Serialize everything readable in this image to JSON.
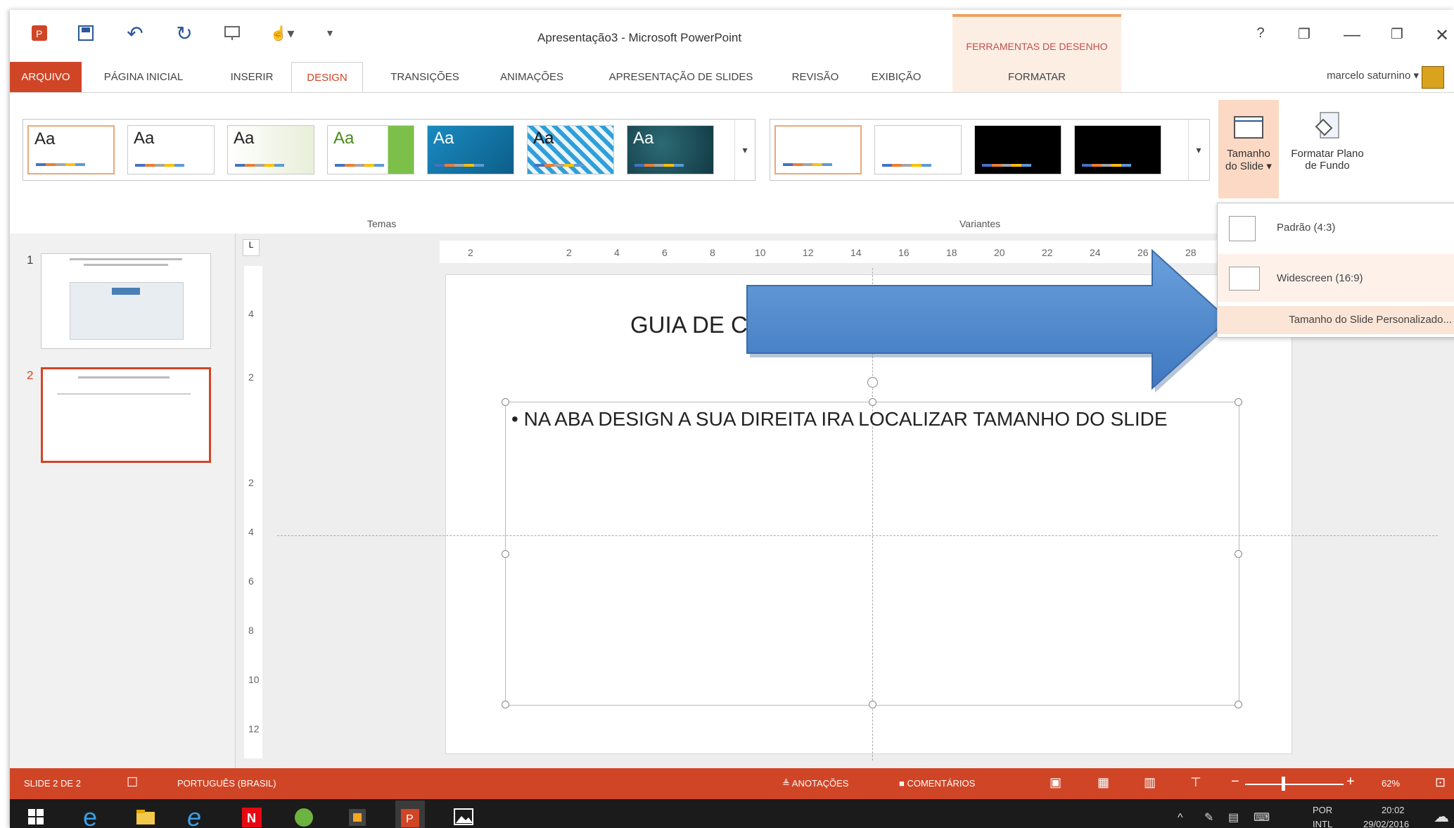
{
  "window": {
    "title": "Apresentação3 - Microsoft PowerPoint"
  },
  "context_tab_header": "FERRAMENTAS DE DESENHO",
  "tabs": [
    "ARQUIVO",
    "PÁGINA INICIAL",
    "INSERIR",
    "DESIGN",
    "TRANSIÇÕES",
    "ANIMAÇÕES",
    "APRESENTAÇÃO DE SLIDES",
    "REVISÃO",
    "EXIBIÇÃO",
    "FORMATAR"
  ],
  "active_tab": "DESIGN",
  "user": {
    "name": "marcelo saturnino"
  },
  "window_controls": {
    "help": "?",
    "minimize": "—",
    "restore": "❐",
    "close": "✕"
  },
  "ribbon": {
    "themes_label": "Temas",
    "variants_label": "Variantes",
    "theme_thumbs": [
      "Aa",
      "Aa",
      "Aa",
      "Aa",
      "Aa",
      "Aa",
      "Aa"
    ],
    "slide_size_btn": [
      "Tamanho",
      "do Slide ▾"
    ],
    "format_bg_btn": [
      "Formatar Plano",
      "de Fundo"
    ]
  },
  "slide_panel": {
    "slides": [
      "1",
      "2"
    ]
  },
  "ruler": {
    "h_ticks": [
      "2",
      "2",
      "4",
      "6",
      "8",
      "10",
      "12",
      "14",
      "16",
      "18",
      "20",
      "22",
      "24",
      "26",
      "28"
    ],
    "v_ticks": [
      "4",
      "2",
      "2",
      "4",
      "6",
      "8",
      "10",
      "12"
    ]
  },
  "slide": {
    "title": "GUIA DE C",
    "body": "• NA ABA DESIGN A SUA DIREITA IRA LOCALIZAR TAMANHO DO SLIDE"
  },
  "dropdown": {
    "items": [
      "Padrão (4:3)",
      "Widescreen (16:9)"
    ],
    "custom": "Tamanho do Slide Personalizado..."
  },
  "statusbar": {
    "slide_info": "SLIDE 2 DE 2",
    "language": "PORTUGUÊS (BRASIL)",
    "notes": "ANOTAÇÕES",
    "comments": "COMENTÁRIOS",
    "zoom": "62%"
  },
  "taskbar": {
    "lang1": "POR",
    "lang2": "INTL",
    "time": "20:02",
    "date": "29/02/2016"
  },
  "colors": {
    "accent": "#d04526",
    "arrow": "#5b8fd0",
    "highlight": "#fbe5d6"
  }
}
